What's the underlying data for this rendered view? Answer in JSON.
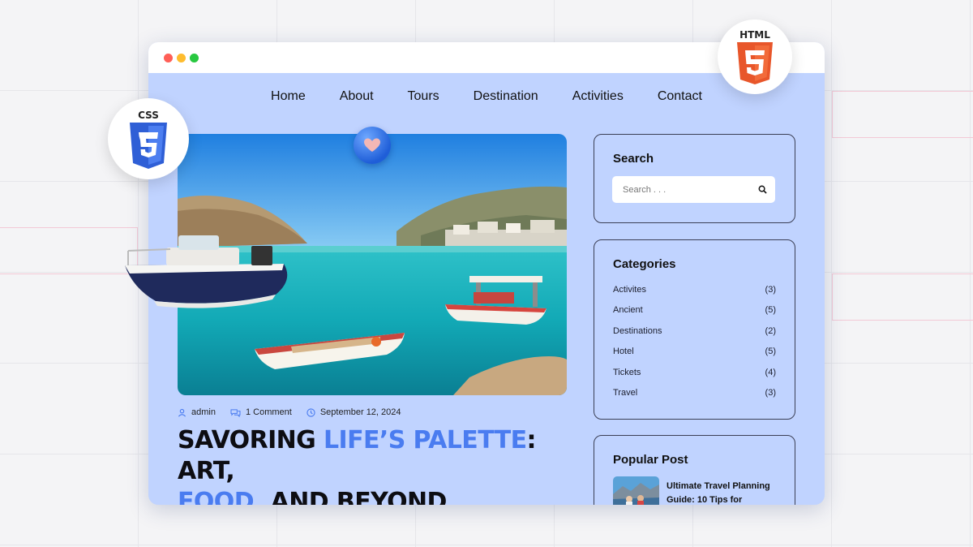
{
  "nav": {
    "items": [
      "Home",
      "About",
      "Tours",
      "Destination",
      "Activities",
      "Contact"
    ]
  },
  "post": {
    "author": "admin",
    "comments": "1 Comment",
    "date": "September 12, 2024",
    "title_parts": {
      "p1": "SAVORING ",
      "p2": "LIFE’S PALETTE",
      "p3": ": ART,",
      "p4": "FOOD",
      "p5": ", AND BEYOND"
    }
  },
  "sidebar": {
    "search": {
      "title": "Search",
      "placeholder": "Search . . ."
    },
    "categories": {
      "title": "Categories",
      "items": [
        {
          "name": "Activites",
          "count": "(3)"
        },
        {
          "name": "Ancient",
          "count": "(5)"
        },
        {
          "name": "Destinations",
          "count": "(2)"
        },
        {
          "name": "Hotel",
          "count": "(5)"
        },
        {
          "name": "Tickets",
          "count": "(4)"
        },
        {
          "name": "Travel",
          "count": "(3)"
        }
      ]
    },
    "popular": {
      "title": "Popular Post",
      "post_title": "Ultimate Travel Planning Guide: 10 Tips for"
    }
  },
  "badges": {
    "css_label": "CSS",
    "css_number": "3",
    "html_label": "HTML",
    "html_number": "5"
  },
  "colors": {
    "page_bg": "#c0d3ff",
    "accent": "#4a7cf0",
    "css_shield": "#2f5fd6",
    "html_shield": "#e8562a"
  },
  "icons": [
    "user-icon",
    "comment-icon",
    "clock-icon",
    "search-icon",
    "heart-icon",
    "css3-logo-icon",
    "html5-logo-icon"
  ]
}
